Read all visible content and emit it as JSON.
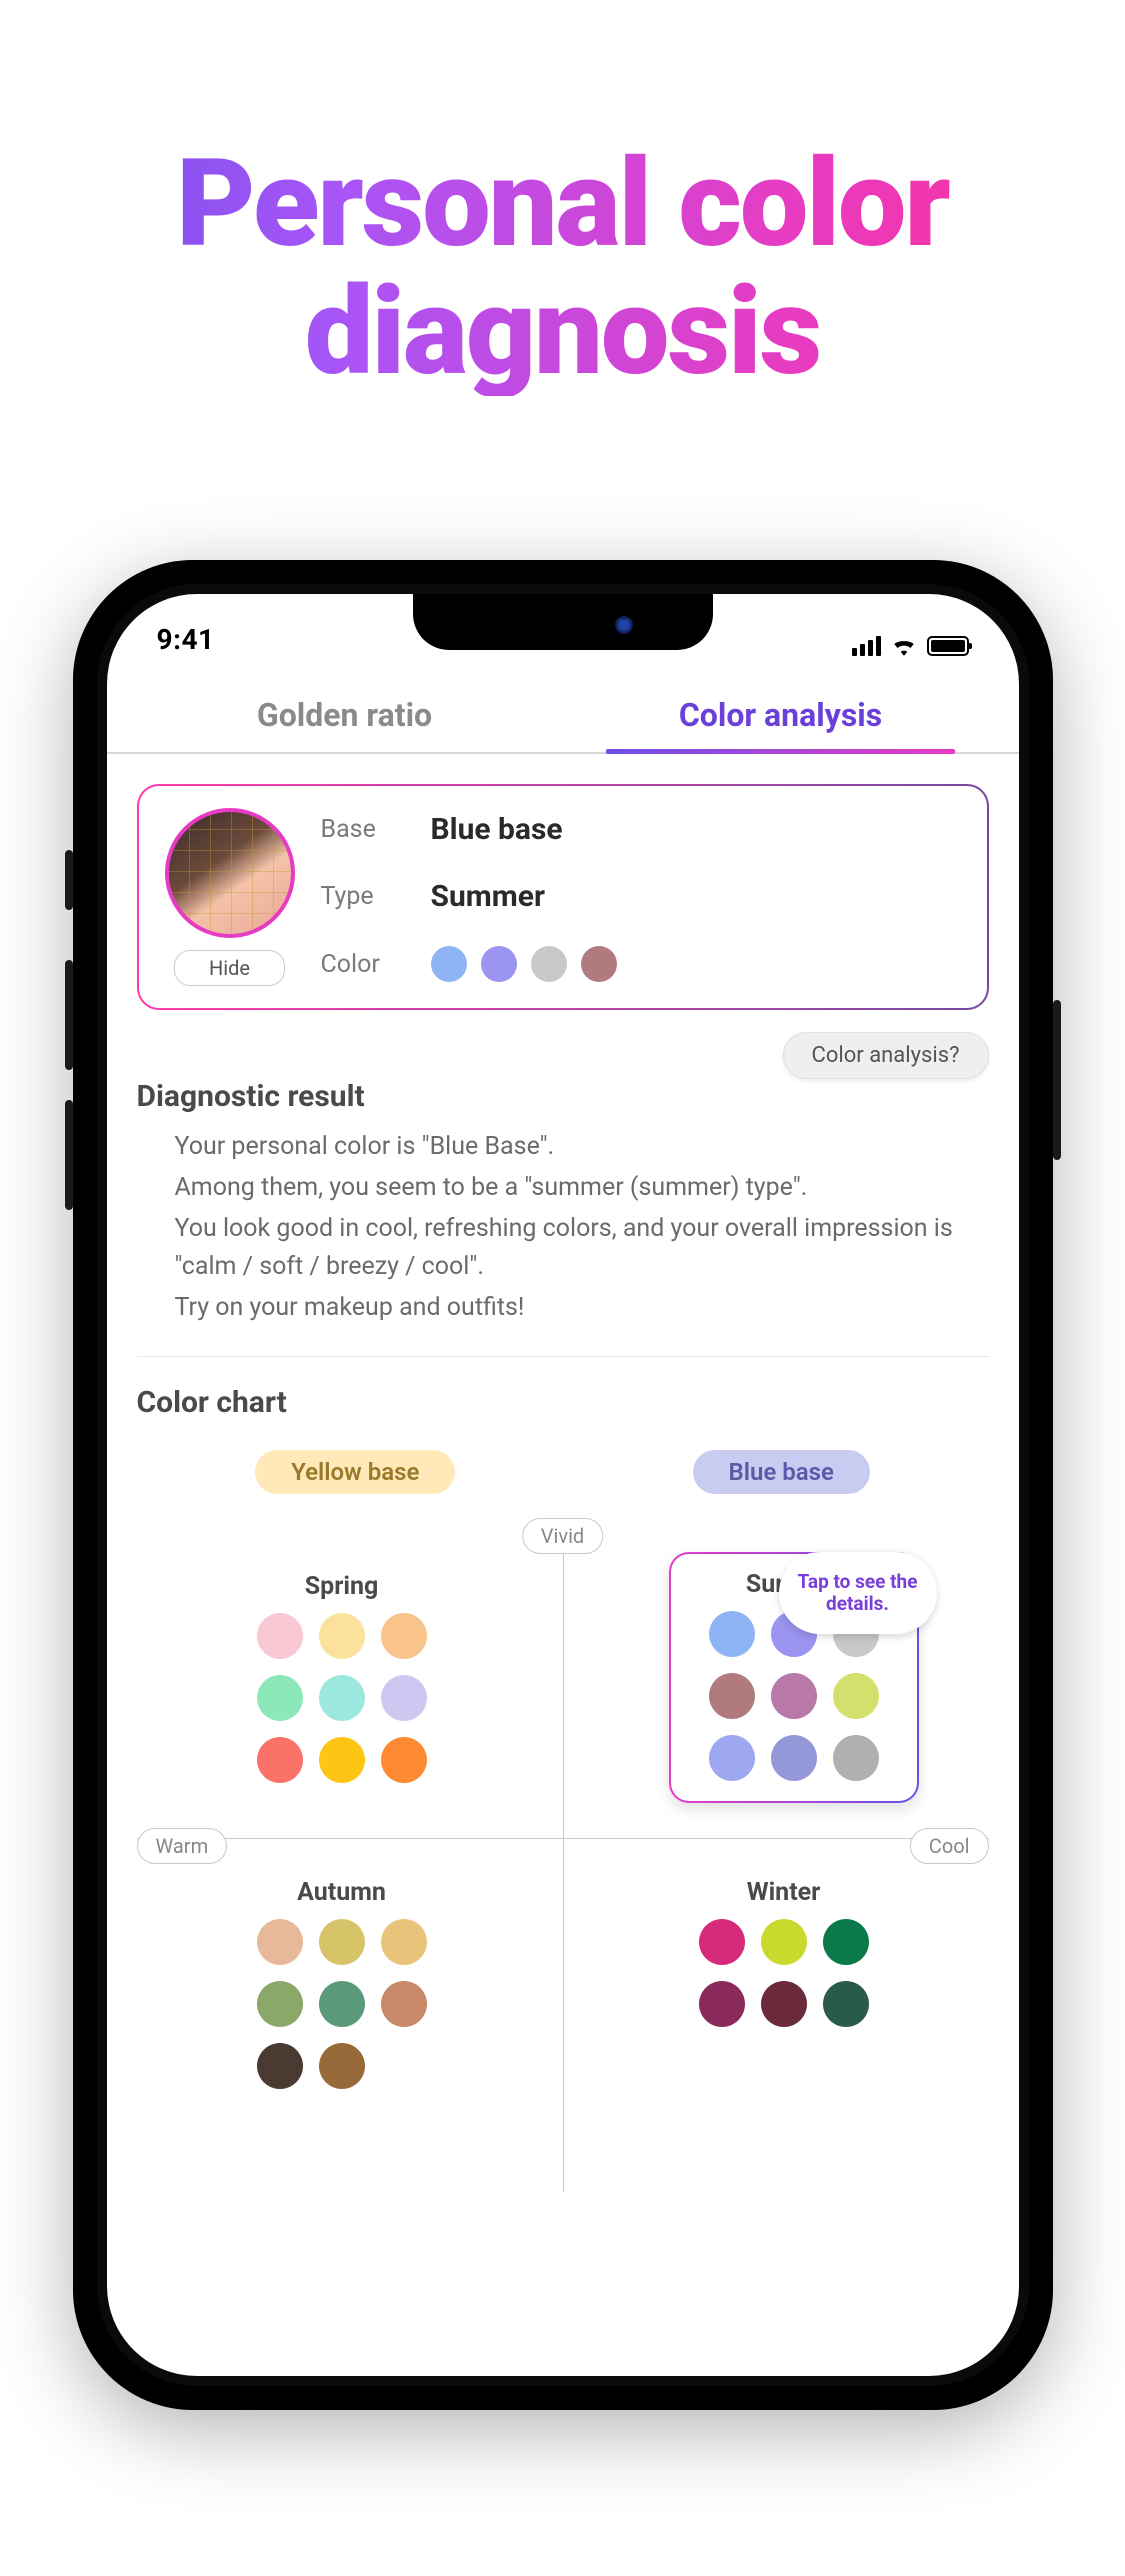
{
  "heading": {
    "line1": "Personal color",
    "line2": "diagnosis"
  },
  "status": {
    "time": "9:41"
  },
  "tabs": [
    {
      "label": "Golden ratio",
      "active": false
    },
    {
      "label": "Color analysis",
      "active": true
    }
  ],
  "result_card": {
    "hide_label": "Hide",
    "labels": {
      "base": "Base",
      "type": "Type",
      "color": "Color"
    },
    "values": {
      "base": "Blue base",
      "type": "Summer"
    },
    "swatches": [
      "#8FB4F5",
      "#9B94F0",
      "#C8C8C8",
      "#B07A7E"
    ]
  },
  "help_button": "Color analysis?",
  "diagnostic": {
    "title": "Diagnostic result",
    "lines": [
      "Your personal color is \"Blue Base\".",
      "Among them, you seem to be a \"summer (summer) type\".",
      "You look good in cool, refreshing colors, and your overall impression is \"calm / soft / breezy / cool\".",
      "Try on your makeup and outfits!"
    ]
  },
  "color_chart": {
    "title": "Color chart",
    "base_labels": {
      "yellow": "Yellow base",
      "blue": "Blue base"
    },
    "axis": {
      "vivid": "Vivid",
      "warm": "Warm",
      "cool": "Cool"
    },
    "tooltip": "Tap to see the details.",
    "seasons": {
      "spring": {
        "label": "Spring",
        "colors": [
          "#F8C9D4",
          "#FBE19B",
          "#F8C48A",
          "#8CE8B8",
          "#9CE8DE",
          "#D0C6F2",
          "#FA7168",
          "#FFC514",
          "#FF8A34"
        ]
      },
      "summer": {
        "label": "Summer",
        "colors": [
          "#8FB4F5",
          "#9B94F0",
          "#C8C8C8",
          "#B07A7E",
          "#B878A8",
          "#D4E06E",
          "#9EA8F0",
          "#9498D8",
          "#B0B0B0"
        ]
      },
      "autumn": {
        "label": "Autumn",
        "colors": [
          "#E8B89A",
          "#D8C468",
          "#E8C47A",
          "#8AA868",
          "#5A9A7A",
          "#C88A68",
          "#4A3A32",
          "#986A3A"
        ]
      },
      "winter": {
        "label": "Winter",
        "colors": [
          "#D82A7A",
          "#C8DA2E",
          "#0A7A4A",
          "#8A2A5A",
          "#6A2A3A",
          "#2A5A4A"
        ]
      }
    }
  }
}
